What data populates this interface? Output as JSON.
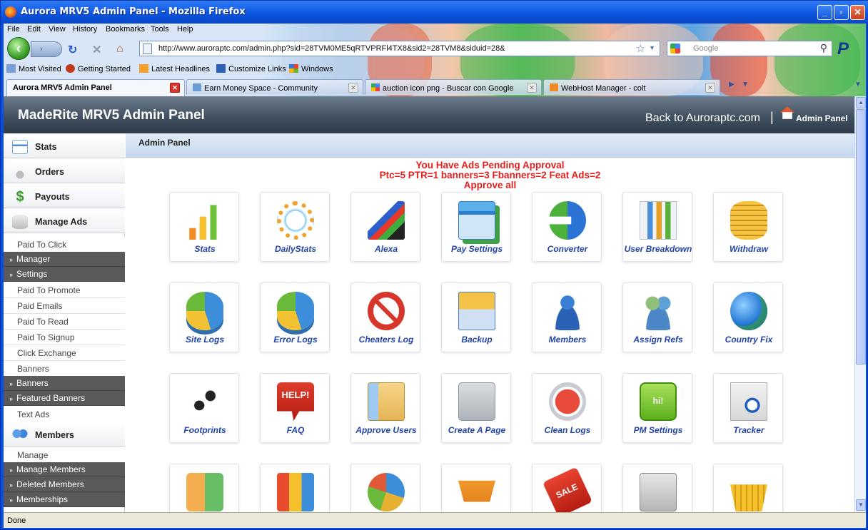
{
  "window": {
    "title": "Aurora MRV5 Admin Panel - Mozilla Firefox"
  },
  "menubar": [
    "File",
    "Edit",
    "View",
    "History",
    "Bookmarks",
    "Tools",
    "Help"
  ],
  "address": {
    "url": "http://www.auroraptc.com/admin.php?sid=28TVM0ME5qRTVPRFl4TX8&sid2=28TVM8&siduid=28&"
  },
  "search": {
    "placeholder": "Google"
  },
  "bookmarks": [
    "Most Visited",
    "Getting Started",
    "Latest Headlines",
    "Customize Links",
    "Windows"
  ],
  "tabs": [
    {
      "label": "Aurora MRV5 Admin Panel",
      "active": true
    },
    {
      "label": "Earn Money Space - Community",
      "active": false
    },
    {
      "label": "auction icon png - Buscar con Google",
      "active": false
    },
    {
      "label": "WebHost Manager - colt",
      "active": false
    }
  ],
  "header": {
    "brand": "MadeRite MRV5 Admin Panel",
    "back_link": "Back to Auroraptc.com",
    "separator": "|",
    "admin_link": "Admin Panel"
  },
  "sidebar": {
    "main": [
      {
        "label": "Stats",
        "icon": "stats-icon"
      },
      {
        "label": "Orders",
        "icon": "cart-icon"
      },
      {
        "label": "Payouts",
        "icon": "dollar-icon"
      },
      {
        "label": "Manage Ads",
        "icon": "database-icon"
      },
      {
        "label": "Members",
        "icon": "members-icon"
      }
    ],
    "ads_items": [
      {
        "label": "Paid To Click",
        "style": "plain"
      },
      {
        "label": "Manager",
        "style": "dark"
      },
      {
        "label": "Settings",
        "style": "dark"
      },
      {
        "label": "Paid To Promote",
        "style": "plain"
      },
      {
        "label": "Paid Emails",
        "style": "plain"
      },
      {
        "label": "Paid To Read",
        "style": "plain"
      },
      {
        "label": "Paid To Signup",
        "style": "plain"
      },
      {
        "label": "Click Exchange",
        "style": "plain"
      },
      {
        "label": "Banners",
        "style": "plain"
      },
      {
        "label": "Banners",
        "style": "dark"
      },
      {
        "label": "Featured Banners",
        "style": "dark"
      },
      {
        "label": "Text Ads",
        "style": "plain"
      }
    ],
    "member_items": [
      {
        "label": "Manage",
        "style": "plain"
      },
      {
        "label": "Manage Members",
        "style": "dark"
      },
      {
        "label": "Deleted Members",
        "style": "dark"
      },
      {
        "label": "Memberships",
        "style": "dark"
      }
    ]
  },
  "main": {
    "breadcrumb": "Admin Panel",
    "alerts": [
      "You Have Ads Pending Approval",
      "Ptc=5 PTR=1 banners=3 Fbanners=2 Feat Ads=2",
      "Approve all"
    ],
    "tiles": [
      {
        "label": "Stats",
        "icon": "bar-chart-icon"
      },
      {
        "label": "DailyStats",
        "icon": "circle-chart-icon"
      },
      {
        "label": "Alexa",
        "icon": "alexa-chart-icon"
      },
      {
        "label": "Pay Settings",
        "icon": "credit-card-icon"
      },
      {
        "label": "Converter",
        "icon": "convert-arrows-icon"
      },
      {
        "label": "User Breakdown",
        "icon": "report-icon"
      },
      {
        "label": "Withdraw",
        "icon": "coins-icon"
      },
      {
        "label": "Site Logs",
        "icon": "pie-chart-icon"
      },
      {
        "label": "Error Logs",
        "icon": "pie-chart-icon"
      },
      {
        "label": "Cheaters Log",
        "icon": "no-sign-icon"
      },
      {
        "label": "Backup",
        "icon": "backup-box-icon"
      },
      {
        "label": "Members",
        "icon": "member-edit-icon"
      },
      {
        "label": "Assign Refs",
        "icon": "users-icon"
      },
      {
        "label": "Country Fix",
        "icon": "globe-icon"
      },
      {
        "label": "Footprints",
        "icon": "footprints-icon"
      },
      {
        "label": "FAQ",
        "icon": "help-bubble-icon"
      },
      {
        "label": "Approve Users",
        "icon": "id-card-icon"
      },
      {
        "label": "Create A Page",
        "icon": "page-edit-icon"
      },
      {
        "label": "Clean Logs",
        "icon": "delete-circle-icon"
      },
      {
        "label": "PM Settings",
        "icon": "chat-bubble-icon"
      },
      {
        "label": "Tracker",
        "icon": "document-search-icon"
      },
      {
        "label": "",
        "icon": "tiles-icon"
      },
      {
        "label": "",
        "icon": "blocks-icon"
      },
      {
        "label": "",
        "icon": "color-pie-icon"
      },
      {
        "label": "",
        "icon": "shopping-cart-icon"
      },
      {
        "label": "",
        "icon": "sale-tag-icon"
      },
      {
        "label": "",
        "icon": "presentation-icon"
      },
      {
        "label": "",
        "icon": "basket-icon"
      }
    ]
  },
  "status": {
    "text": "Done"
  }
}
